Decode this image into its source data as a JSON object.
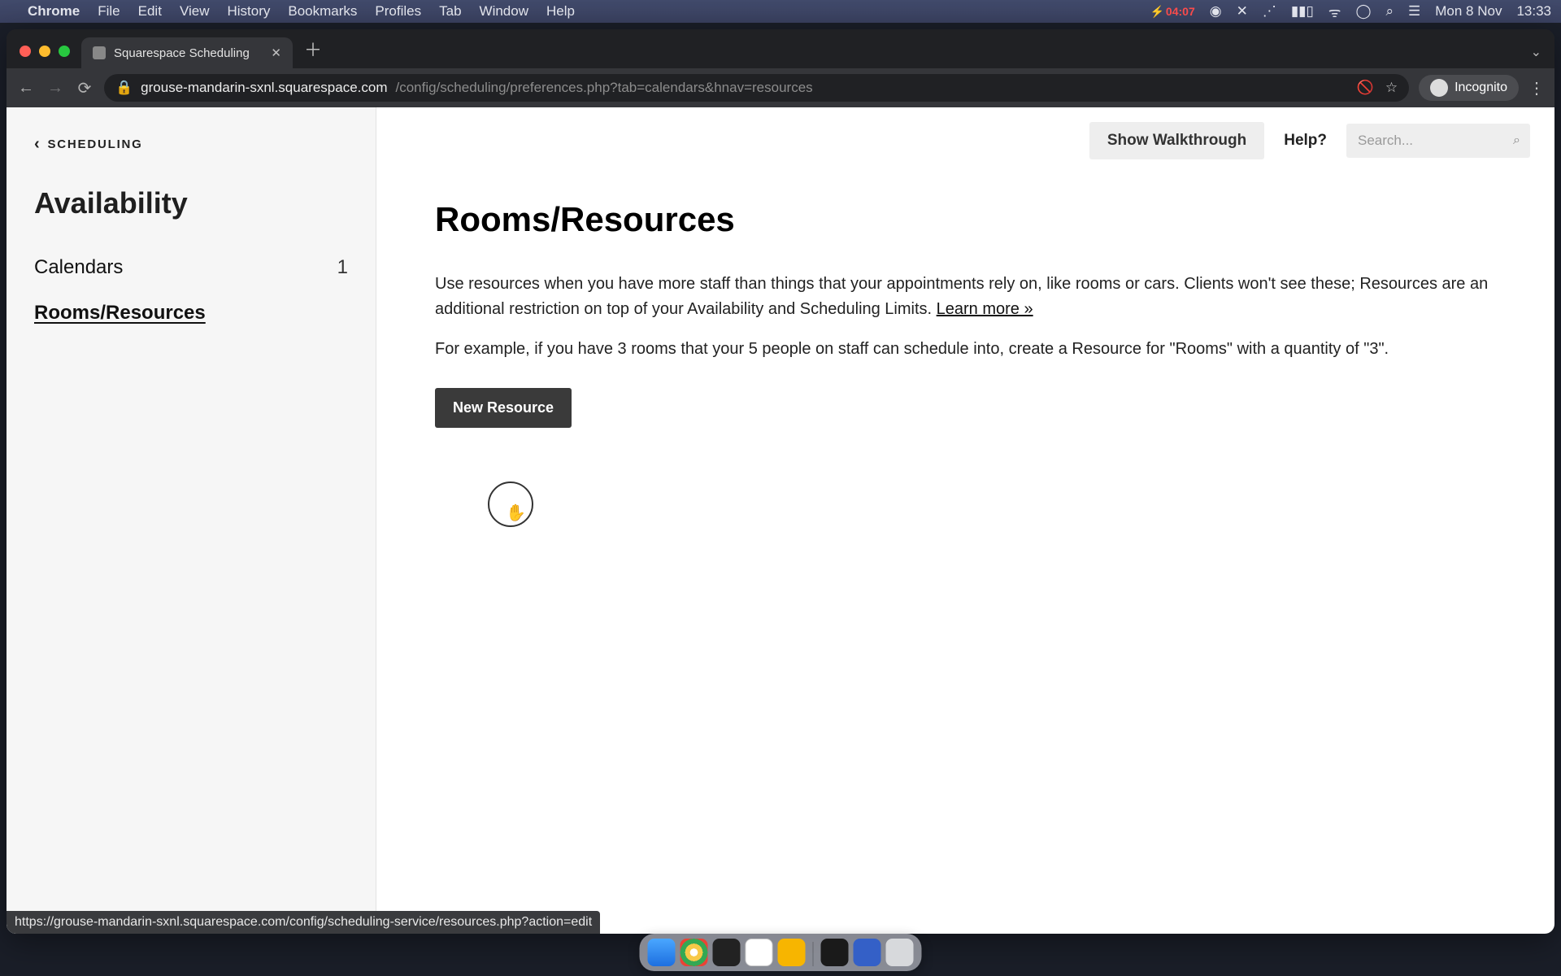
{
  "menubar": {
    "app": "Chrome",
    "items": [
      "File",
      "Edit",
      "View",
      "History",
      "Bookmarks",
      "Profiles",
      "Tab",
      "Window",
      "Help"
    ],
    "battery_time": "04:07",
    "date": "Mon 8 Nov",
    "clock": "13:33"
  },
  "browser": {
    "tab_title": "Squarespace Scheduling",
    "url_host": "grouse-mandarin-sxnl.squarespace.com",
    "url_path": "/config/scheduling/preferences.php?tab=calendars&hnav=resources",
    "incognito_label": "Incognito",
    "status_url": "https://grouse-mandarin-sxnl.squarespace.com/config/scheduling-service/resources.php?action=edit"
  },
  "sidebar": {
    "back_label": "SCHEDULING",
    "title": "Availability",
    "items": [
      {
        "label": "Calendars",
        "count": "1",
        "active": false
      },
      {
        "label": "Rooms/Resources",
        "count": "",
        "active": true
      }
    ]
  },
  "top_actions": {
    "walkthrough": "Show Walkthrough",
    "help": "Help?",
    "search_placeholder": "Search..."
  },
  "main": {
    "title": "Rooms/Resources",
    "paragraph_lead": "Use resources when you have more staff than things that your appointments rely on, like rooms or cars. Clients won't see these; Resources are an additional restriction on top of your Availability and Scheduling Limits. ",
    "learn_more": "Learn more »",
    "example": "For example, if you have 3 rooms that your 5 people on staff can schedule into, create a Resource for \"Rooms\" with a quantity of \"3\".",
    "new_button": "New Resource"
  }
}
